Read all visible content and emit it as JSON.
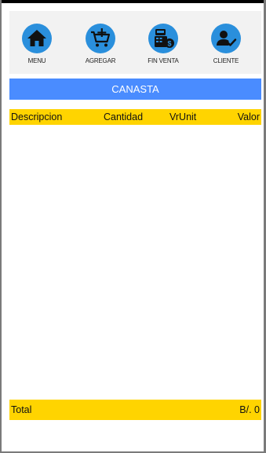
{
  "toolbar": {
    "buttons": [
      {
        "label": "MENU",
        "icon": "home-icon"
      },
      {
        "label": "AGREGAR",
        "icon": "cart-add-icon"
      },
      {
        "label": "FIN VENTA",
        "icon": "register-payment-icon"
      },
      {
        "label": "CLIENTE",
        "icon": "user-check-icon"
      }
    ],
    "accent": "#2a8fdc"
  },
  "header": {
    "title": "CANASTA",
    "color": "#4a8cff"
  },
  "table": {
    "columns": [
      "Descripcion",
      "Cantidad",
      "VrUnit",
      "Valor"
    ],
    "rows": [],
    "header_color": "#ffd400"
  },
  "footer": {
    "total_label": "Total",
    "total_value": "B/. 0"
  }
}
